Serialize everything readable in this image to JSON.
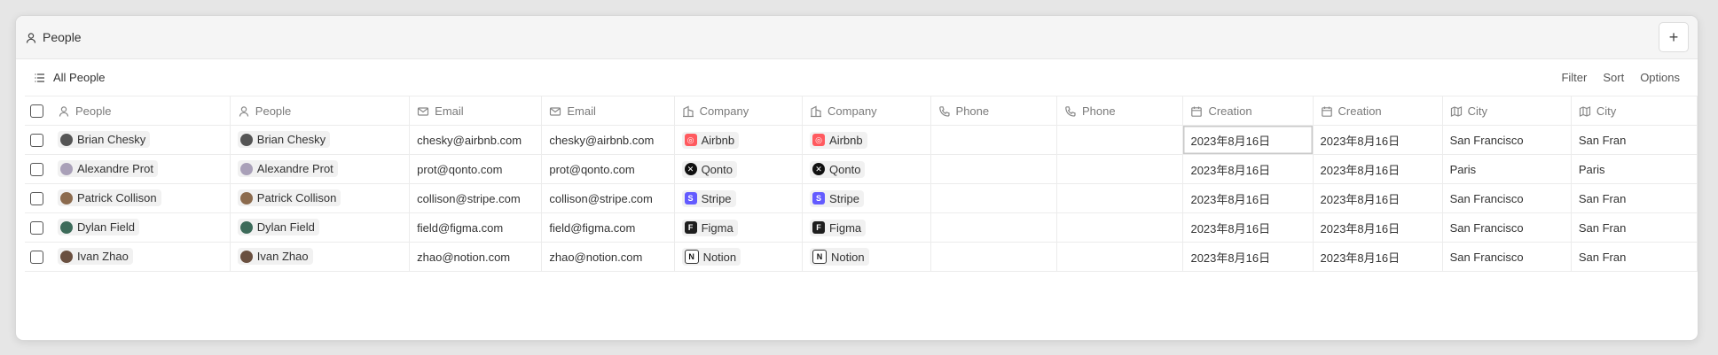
{
  "window": {
    "title": "People",
    "add_icon": "plus-icon"
  },
  "view": {
    "name": "All People",
    "actions": [
      "Filter",
      "Sort",
      "Options"
    ]
  },
  "columns": [
    {
      "label": "People",
      "icon": "person-icon"
    },
    {
      "label": "People",
      "icon": "person-icon"
    },
    {
      "label": "Email",
      "icon": "mail-icon"
    },
    {
      "label": "Email",
      "icon": "mail-icon"
    },
    {
      "label": "Company",
      "icon": "building-icon"
    },
    {
      "label": "Company",
      "icon": "building-icon"
    },
    {
      "label": "Phone",
      "icon": "phone-icon"
    },
    {
      "label": "Phone",
      "icon": "phone-icon"
    },
    {
      "label": "Creation",
      "icon": "calendar-icon"
    },
    {
      "label": "Creation",
      "icon": "calendar-icon"
    },
    {
      "label": "City",
      "icon": "map-icon"
    },
    {
      "label": "City",
      "icon": "map-icon"
    }
  ],
  "rows": [
    {
      "name": "Brian Chesky",
      "email": "chesky@airbnb.com",
      "company": "Airbnb",
      "phone": "",
      "created": "2023年8月16日",
      "city": "San Francisco",
      "city_cut": "San Fran"
    },
    {
      "name": "Alexandre Prot",
      "email": "prot@qonto.com",
      "company": "Qonto",
      "phone": "",
      "created": "2023年8月16日",
      "city": "Paris",
      "city_cut": "Paris"
    },
    {
      "name": "Patrick Collison",
      "email": "collison@stripe.com",
      "company": "Stripe",
      "phone": "",
      "created": "2023年8月16日",
      "city": "San Francisco",
      "city_cut": "San Fran"
    },
    {
      "name": "Dylan Field",
      "email": "field@figma.com",
      "company": "Figma",
      "phone": "",
      "created": "2023年8月16日",
      "city": "San Francisco",
      "city_cut": "San Fran"
    },
    {
      "name": "Ivan Zhao",
      "email": "zhao@notion.com",
      "company": "Notion",
      "phone": "",
      "created": "2023年8月16日",
      "city": "San Francisco",
      "city_cut": "San Fran"
    }
  ],
  "colors": {
    "airbnb": "#ff5a5f",
    "qonto": "#111111",
    "stripe": "#635bff",
    "figma": "#1e1e1e",
    "notion": "#ffffff"
  }
}
